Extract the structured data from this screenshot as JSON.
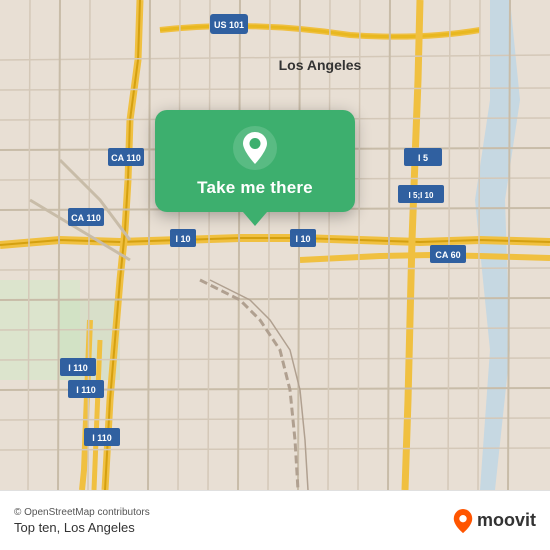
{
  "map": {
    "attribution": "© OpenStreetMap contributors",
    "location_label": "Top ten, Los Angeles",
    "popup": {
      "button_label": "Take me there"
    },
    "accent_color": "#3daf6e",
    "moovit_text": "moovit"
  }
}
